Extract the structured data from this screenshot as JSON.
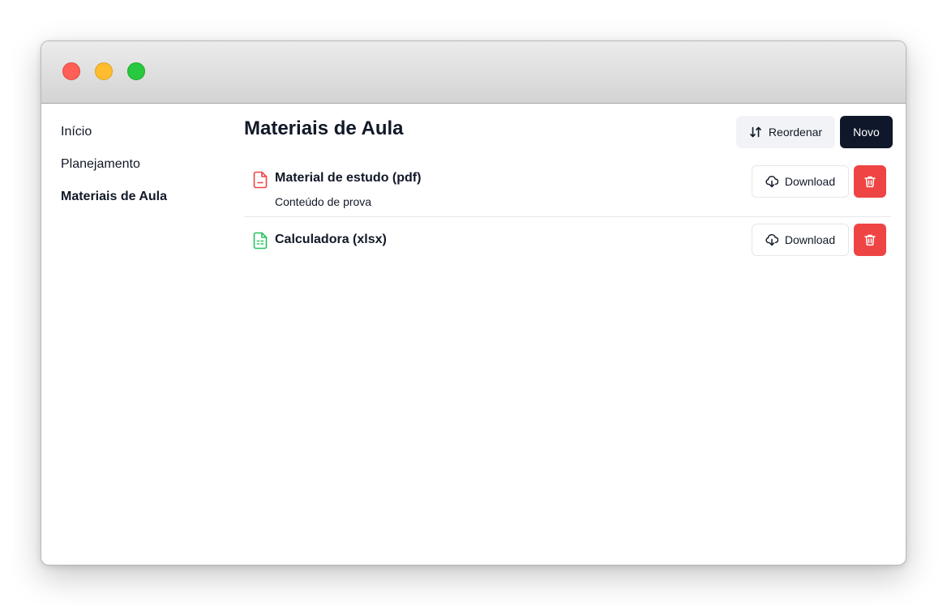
{
  "sidebar": {
    "items": [
      {
        "label": "Início"
      },
      {
        "label": "Planejamento"
      },
      {
        "label": "Materiais de Aula"
      }
    ]
  },
  "main": {
    "title": "Materiais de Aula",
    "reorder_label": "Reordenar",
    "new_label": "Novo",
    "items": [
      {
        "title": "Material de estudo (pdf)",
        "subtitle": "Conteúdo de prova",
        "download_label": "Download",
        "icon": "file-pdf-icon",
        "icon_color": "#ef4444"
      },
      {
        "title": "Calculadora (xlsx)",
        "download_label": "Download",
        "icon": "file-spreadsheet-icon",
        "icon_color": "#22c55e"
      }
    ]
  },
  "colors": {
    "accent_dark": "#0f172a",
    "danger": "#ef4444",
    "pdf_icon": "#ef4444",
    "sheet_icon": "#22c55e"
  }
}
